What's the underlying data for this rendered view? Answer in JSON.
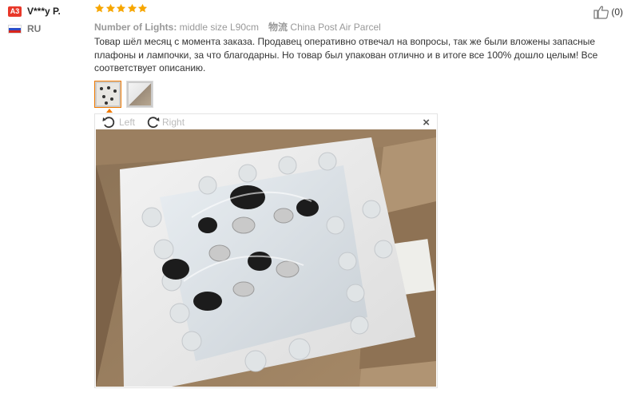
{
  "reviewer": {
    "badge": "A3",
    "name": "V***y P.",
    "country": "RU",
    "flag_colors": [
      "#ffffff",
      "#2c4ec9",
      "#d9261c"
    ]
  },
  "rating": {
    "value": 5,
    "max": 5,
    "star_color": "#f7a600"
  },
  "helpful": {
    "count_label": "(0)",
    "icon": "thumbs-up-icon"
  },
  "properties": {
    "lights_label": "Number of Lights:",
    "lights_value": "middle size L90cm",
    "shipping_label": "物流",
    "shipping_value": "China Post Air Parcel"
  },
  "review_text": "Товар шёл месяц с момента заказа. Продавец оперативно отвечал на вопросы, так же были вложены запасные плафоны и лампочки, за что благодарны. Но товар был упакован отлично и в итоге все 100% дошло целым! Все соответствует описанию.",
  "thumbnails": [
    {
      "name": "photo-1",
      "selected": true
    },
    {
      "name": "photo-2",
      "selected": false
    }
  ],
  "viewer": {
    "rotate_left_label": "Left",
    "rotate_right_label": "Right",
    "close_label": "×"
  },
  "accent_color": "#f07a00"
}
